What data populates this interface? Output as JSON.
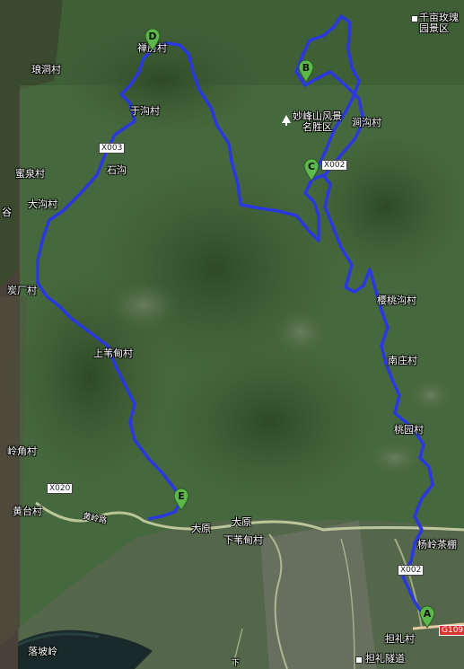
{
  "map": {
    "labels": {
      "qianmu": "千亩玫瑰\n园景区",
      "langdong": "琅洞村",
      "chanfang": "禅房村",
      "yugou": "于沟村",
      "miquan": "蜜泉村",
      "shigou": "石沟",
      "dagou": "大沟村",
      "gu": "谷",
      "tanchang": "炭厂村",
      "miaofengshan": "妙峰山风景\n名胜区",
      "jiangou": "涧沟村",
      "yingtaogou": "樱桃沟村",
      "nanzhuang": "南庄村",
      "shangweidian": "上苇甸村",
      "taoyuan": "桃园村",
      "lingjiao": "岭角村",
      "huangtai": "黄台村",
      "huangling_road": "黄岭路",
      "dayuan1": "大原",
      "dayuan2": "大原",
      "xiaweidian": "下苇甸村",
      "yanglingchapeng": "杨岭茶棚",
      "luopoling": "落坡岭",
      "danli": "担礼村",
      "danli_tunnel": "担礼隧道",
      "xia": "下"
    },
    "roads": {
      "x003": "X003",
      "x002a": "X002",
      "x002b": "X002",
      "x020": "X020",
      "g109": "G109"
    },
    "markers": [
      "A",
      "B",
      "C",
      "D",
      "E"
    ],
    "colors": {
      "route": "#3344ee",
      "marker_fill": "#5cb84a",
      "highway": "#d9342b"
    }
  }
}
